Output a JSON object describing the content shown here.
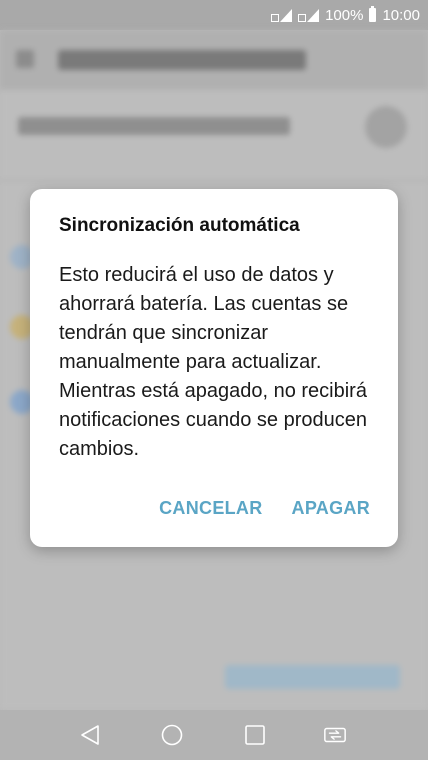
{
  "status_bar": {
    "battery_percent": "100%",
    "time": "10:00",
    "icons": [
      "signal-sim1-icon",
      "signal-sim2-icon",
      "battery-icon"
    ]
  },
  "dialog": {
    "title": "Sincronización automática",
    "message": "Esto reducirá el uso de datos y ahorrará batería. Las cuentas se tendrán que sincronizar manualmente para actualizar. Mientras está apagado, no recibirá notificaciones cuando se producen cambios.",
    "cancel_label": "CANCELAR",
    "confirm_label": "APAGAR",
    "accent_color": "#5aa5c5"
  },
  "nav_bar": {
    "icons": [
      "back-icon",
      "home-icon",
      "recent-apps-icon",
      "dual-window-icon"
    ]
  }
}
